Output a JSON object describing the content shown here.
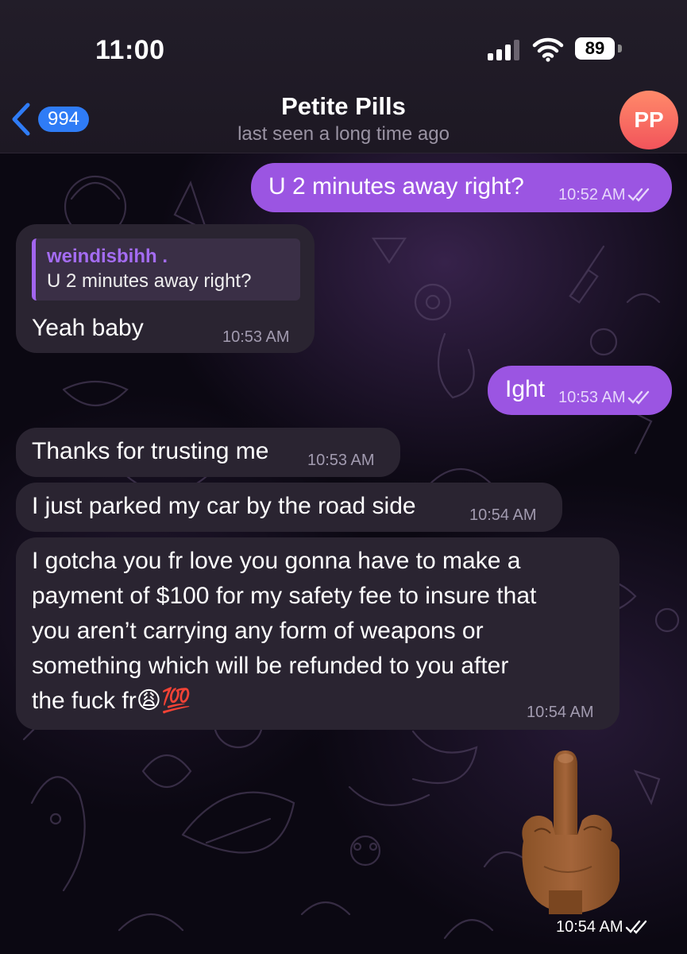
{
  "status_bar": {
    "time": "11:00",
    "battery": "89"
  },
  "header": {
    "back_count": "994",
    "title": "Petite Pills",
    "subtitle": "last seen a long time ago",
    "avatar_initials": "PP"
  },
  "messages": [
    {
      "direction": "out",
      "text": "U 2 minutes away right?",
      "time": "10:52 AM"
    },
    {
      "direction": "in",
      "reply_to_name": "weindisbihh .",
      "reply_to_text": "U 2 minutes away right?",
      "text": "Yeah baby",
      "time": "10:53 AM"
    },
    {
      "direction": "out",
      "text": "Ight",
      "time": "10:53 AM"
    },
    {
      "direction": "in",
      "text": "Thanks for trusting me",
      "time": "10:53 AM"
    },
    {
      "direction": "in",
      "text": "I just parked my car by the road side",
      "time": "10:54 AM"
    },
    {
      "direction": "in",
      "lines": [
        "I gotcha you fr love you gonna have to make a",
        "payment of $100 for my safety fee to insure that",
        "you aren’t carrying any form of weapons or",
        "something which will be refunded to you after",
        "the fuck fr😩💯"
      ],
      "time": "10:54 AM"
    },
    {
      "direction": "out",
      "type": "emoji",
      "emoji": "middle-finger-emoji",
      "time": "10:54 AM"
    }
  ],
  "colors": {
    "outgoing_bubble": "#9b55e2",
    "incoming_bubble": "#2a2431",
    "accent": "#2f7cf6",
    "avatar": "#f2545b"
  }
}
